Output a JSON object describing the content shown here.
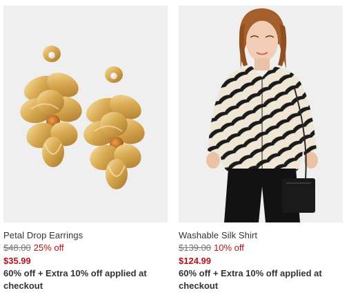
{
  "products": [
    {
      "name": "Petal Drop Earrings",
      "original_price": "$48.00",
      "discount_percent": "25% off",
      "sale_price": "$35.99",
      "promo_text": "60% off + Extra 10% off applied at checkout"
    },
    {
      "name": "Washable Silk Shirt",
      "original_price": "$139.00",
      "discount_percent": "10% off",
      "sale_price": "$124.99",
      "promo_text": "60% off + Extra 10% off applied at checkout"
    }
  ],
  "colors": {
    "sale_red": "#b5121b",
    "text_dark": "#333333",
    "text_muted": "#757575",
    "image_bg": "#efefef"
  }
}
